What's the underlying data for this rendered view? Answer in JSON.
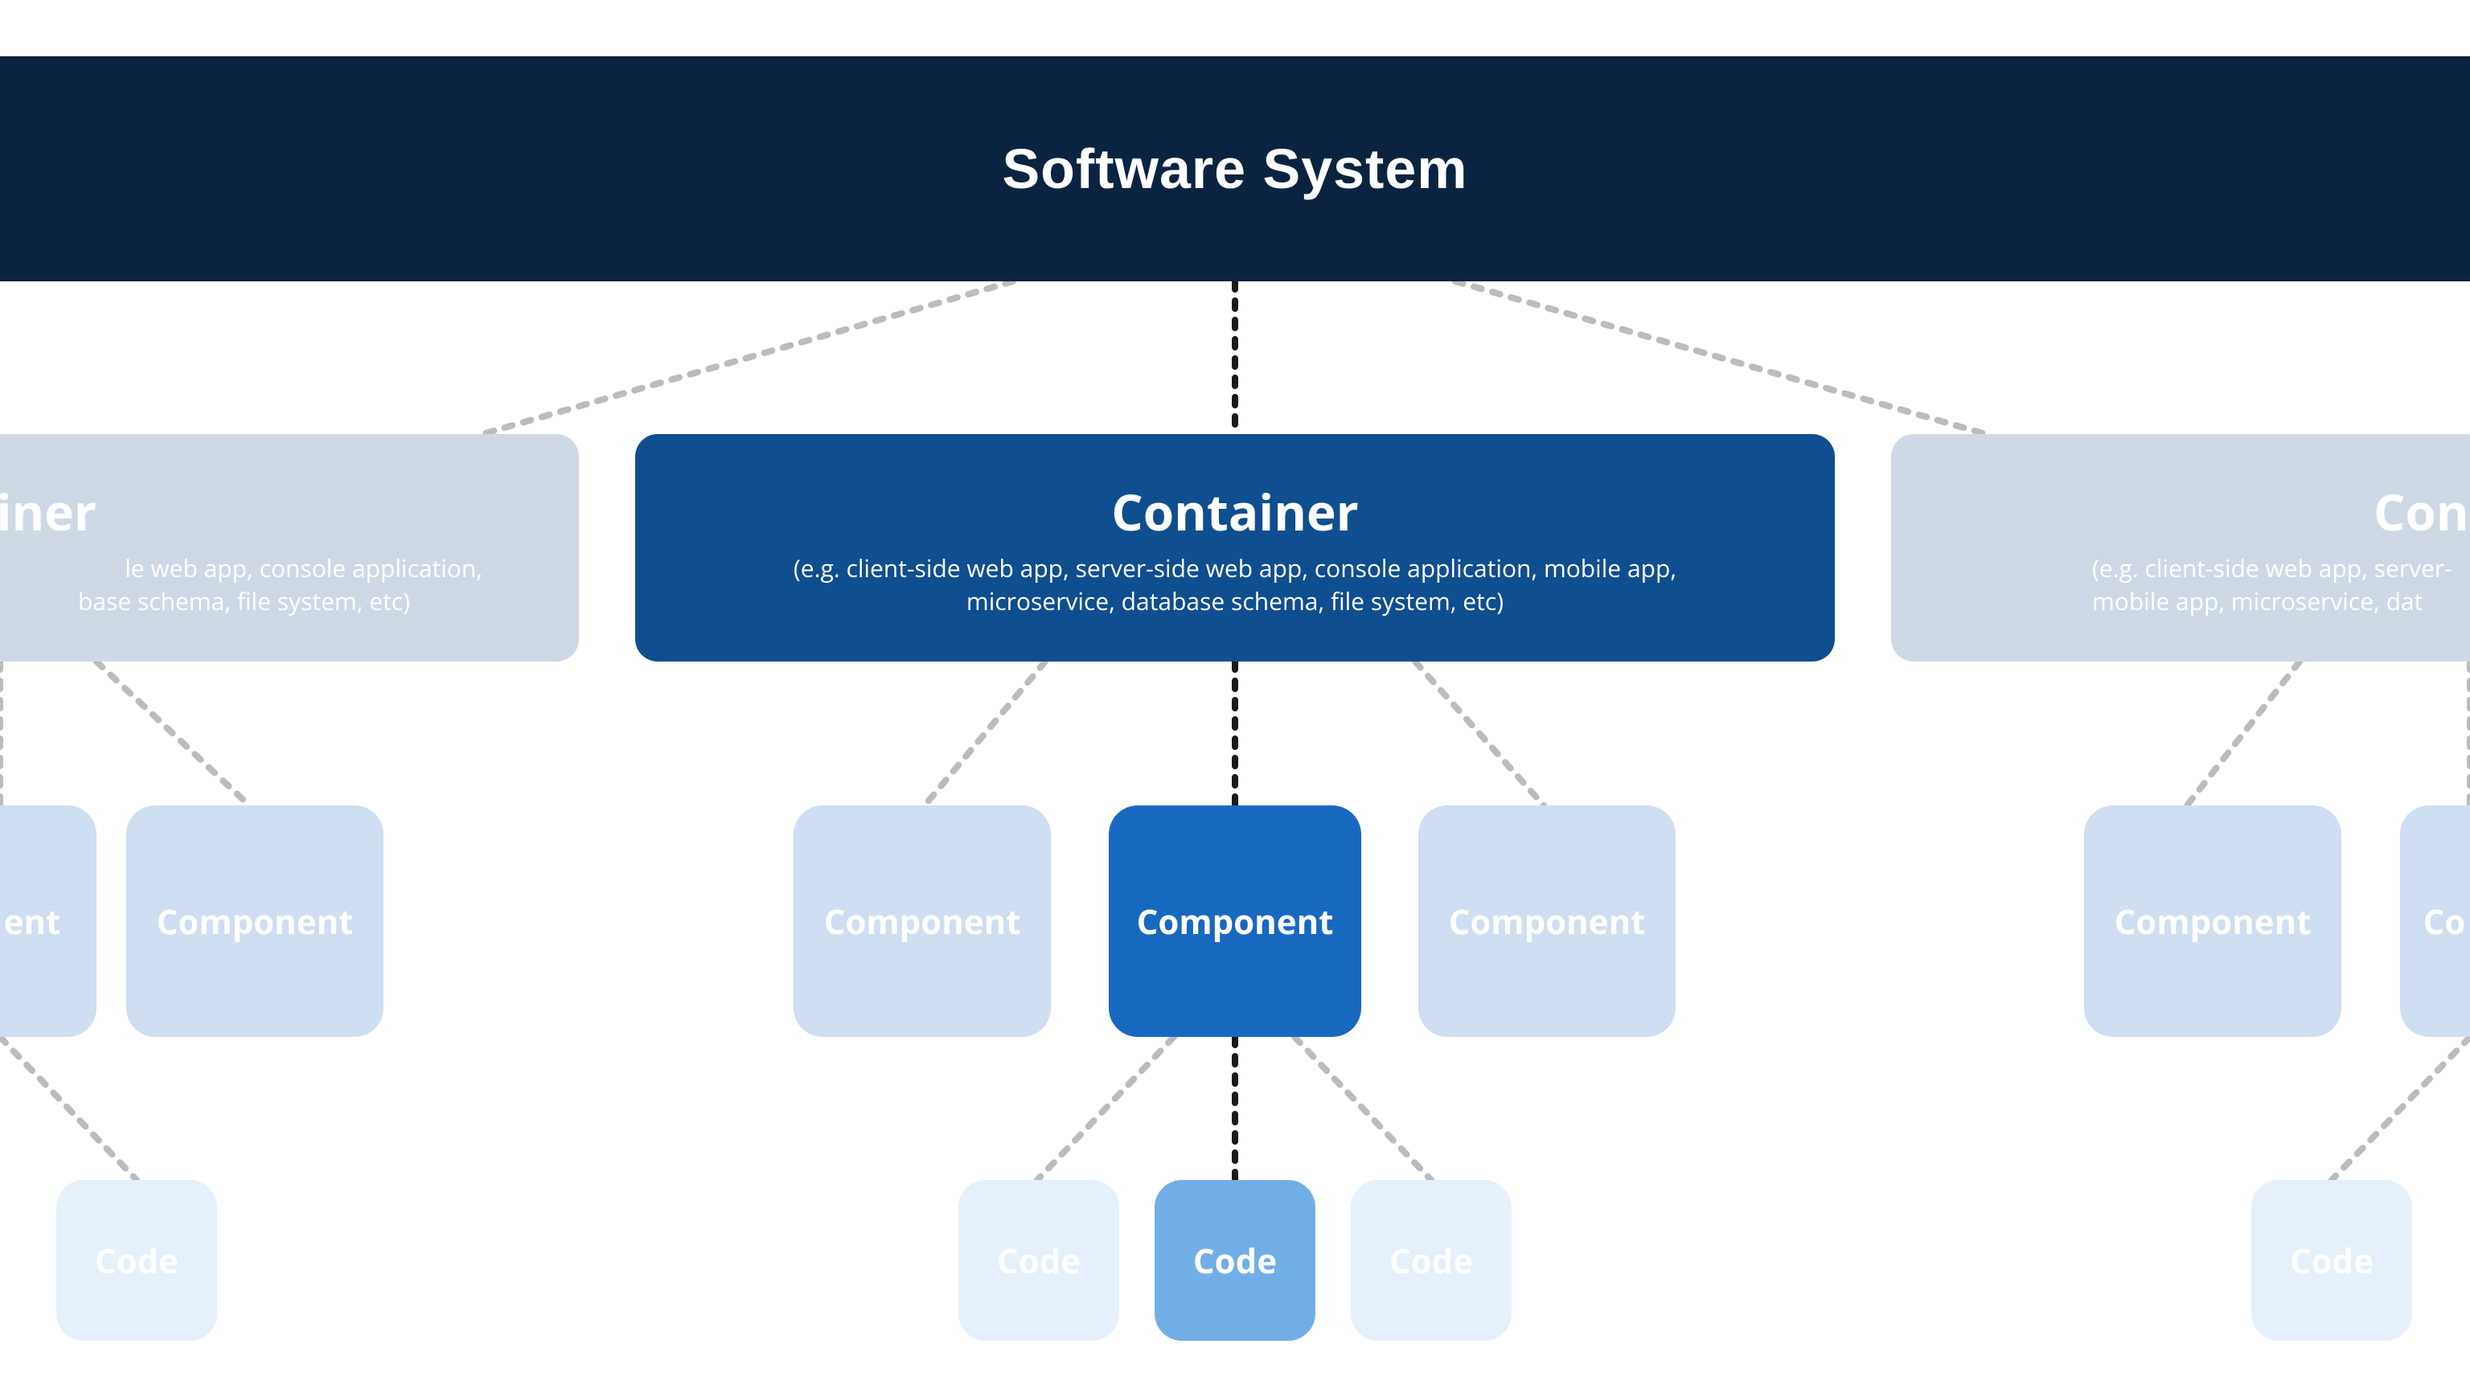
{
  "colors": {
    "system_bg": "#0a2340",
    "container_active_bg": "#0f4e8f",
    "container_faded_bg": "#cfd9e6",
    "component_active_bg": "#1769c0",
    "component_faded_bg": "#cfdef0",
    "code_active_bg": "#72aee6",
    "code_faded_bg": "#e6f0fa",
    "dotted_dark": "#1a1a1a",
    "dotted_light": "#bcbcbc"
  },
  "system": {
    "title": "Software System"
  },
  "containers": {
    "left": {
      "title_frag": "iner",
      "subtitle_line1_frag": "le web app, console application,",
      "subtitle_line2_frag": "base schema, file system, etc)"
    },
    "center": {
      "title": "Container",
      "subtitle": "(e.g. client-side web app, server-side web app, console application, mobile app, microservice, database schema, file system, etc)"
    },
    "right": {
      "title_frag": "Cont",
      "subtitle_line1_frag": "(e.g. client-side web app, server-",
      "subtitle_line2_frag": "mobile app, microservice, dat"
    }
  },
  "components": {
    "label": "Component"
  },
  "code": {
    "label": "Code"
  }
}
